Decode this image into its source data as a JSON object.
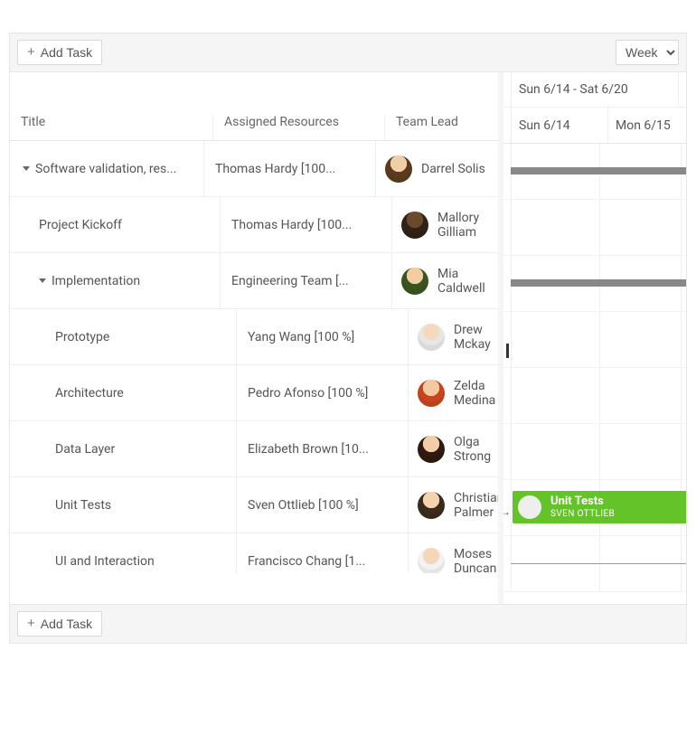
{
  "toolbar": {
    "add_task": "Add Task",
    "view_selector": "Week"
  },
  "columns": {
    "title": "Title",
    "resources": "Assigned Resources",
    "lead": "Team Lead"
  },
  "timeline": {
    "range_label": "Sun 6/14 - Sat 6/20",
    "days": [
      "Sun 6/14",
      "Mon 6/15"
    ]
  },
  "rows": [
    {
      "type": "group",
      "indent": 0,
      "title": "Software validation, res...",
      "resources": "Thomas Hardy [100...",
      "lead": "Darrel Solis",
      "lead_avatar": "av1",
      "right": "groupbar"
    },
    {
      "type": "child",
      "indent": 1,
      "title": "Project Kickoff",
      "resources": "Thomas Hardy [100...",
      "lead": "Mallory Gilliam",
      "lead_avatar": "av2",
      "right": ""
    },
    {
      "type": "group",
      "indent": 1,
      "title": "Implementation",
      "resources": "Engineering Team [...",
      "lead": "Mia Caldwell",
      "lead_avatar": "av3",
      "right": "groupbar"
    },
    {
      "type": "child",
      "indent": 2,
      "title": "Prototype",
      "resources": "Yang Wang [100 %]",
      "lead": "Drew Mckay",
      "lead_avatar": "av4",
      "right": "tinybar"
    },
    {
      "type": "child",
      "indent": 2,
      "title": "Architecture",
      "resources": "Pedro Afonso [100 %]",
      "lead": "Zelda Medina",
      "lead_avatar": "av5",
      "right": ""
    },
    {
      "type": "child",
      "indent": 2,
      "title": "Data Layer",
      "resources": "Elizabeth Brown [10...",
      "lead": "Olga Strong",
      "lead_avatar": "av6",
      "right": ""
    },
    {
      "type": "child",
      "indent": 2,
      "title": "Unit Tests",
      "resources": "Sven Ottlieb [100 %]",
      "lead": "Christian Palmer",
      "lead_avatar": "av7",
      "right": "card"
    },
    {
      "type": "child",
      "indent": 2,
      "title": "UI and Interaction",
      "resources": "Francisco Chang [1...",
      "lead": "Moses Duncan",
      "lead_avatar": "av8",
      "right": "thinline"
    }
  ],
  "card": {
    "title": "Unit Tests",
    "subtitle": "SVEN OTTLIEB",
    "color": "#64c328"
  }
}
